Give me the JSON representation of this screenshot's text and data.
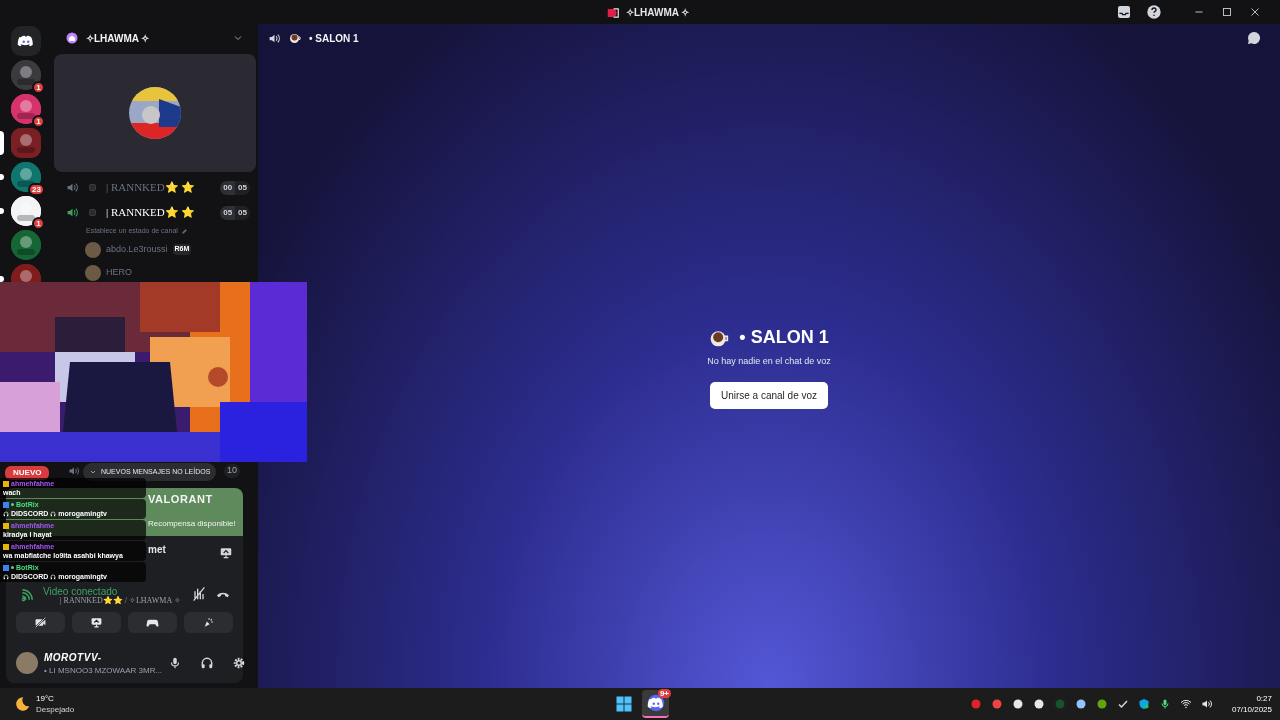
{
  "window": {
    "title": "✧LHAWMA ✧"
  },
  "servers": [
    {
      "kind": "home",
      "selected": false,
      "unread": false
    },
    {
      "kind": "server",
      "selected": false,
      "unread": false,
      "badge": "1"
    },
    {
      "kind": "server",
      "selected": false,
      "unread": false,
      "badge": "1"
    },
    {
      "kind": "server",
      "selected": true,
      "unread": false
    },
    {
      "kind": "server",
      "selected": false,
      "unread": true,
      "badge": "23"
    },
    {
      "kind": "server",
      "selected": false,
      "unread": true,
      "badge": "1"
    },
    {
      "kind": "server",
      "selected": false,
      "unread": false
    },
    {
      "kind": "server",
      "selected": false,
      "unread": true
    }
  ],
  "guild": {
    "name": "✧LHAWMA ✧"
  },
  "channels": [
    {
      "name": "| RANNKED⭐ ⭐",
      "connected": false,
      "user_count": "00",
      "user_limit": "05"
    },
    {
      "name": "| RANNKED⭐ ⭐",
      "connected": true,
      "user_count": "05",
      "user_limit": "05"
    }
  ],
  "channel_status": "Establece un estado de canal",
  "voice_users": [
    {
      "name": "abdo.Le3roussi",
      "tag": "R6M"
    },
    {
      "name": "HERO"
    }
  ],
  "hidden_channel_count": "10",
  "new_pill": "NUEVO",
  "unread_pill": "NUEVOS MENSAJES NO LEÍDOS",
  "promo": {
    "title": "VALORANT",
    "subtitle": "Recompensa disponible!"
  },
  "partial_row": "met",
  "chat_overlay": [
    {
      "author": "ahmehfahme",
      "kind": "user",
      "text": "wach"
    },
    {
      "author": "BotRix",
      "kind": "bot",
      "text": "DIDSCORD",
      "mention": "morogamingtv"
    },
    {
      "author": "ahmehfahme",
      "kind": "user",
      "text": "kiradya l hayat"
    },
    {
      "author": "ahmehfahme",
      "kind": "user",
      "text": "wa mabfiatche lo9ita asahbi khawya"
    },
    {
      "author": "BotRix",
      "kind": "bot",
      "text": "DIDSCORD",
      "mention": "morogamingtv"
    }
  ],
  "voice_panel": {
    "status": "Video conectado",
    "location": "| RANNKED⭐⭐ / ✧LHAWMA ✧"
  },
  "user": {
    "name": "MOROTVV-",
    "status": "• LI MSNOO3 MZOWAAR 3MR..."
  },
  "main": {
    "channel": "• SALON 1",
    "heading": "• SALON 1",
    "empty_text": "No hay nadie en el chat de voz",
    "join_button": "Unirse a canal de voz"
  },
  "taskbar": {
    "temperature": "19°C",
    "weather": "Despejado",
    "discord_badge": "9+",
    "time": "0:27",
    "date": "07/10/2025"
  }
}
